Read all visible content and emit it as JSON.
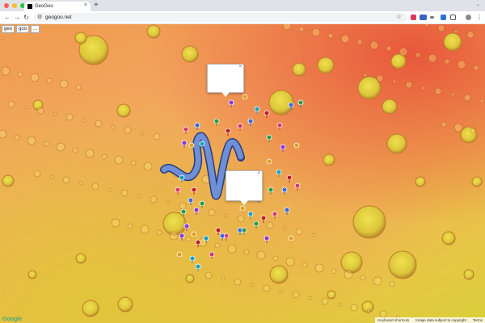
{
  "browser": {
    "tab_title": "GeoGoo",
    "tab_close": "×",
    "new_tab": "+",
    "tab_menu": "⌄",
    "url": "geogoo.net",
    "back": "←",
    "forward": "→",
    "reload": "↻",
    "menu": "⋮",
    "star": "☆",
    "traffic_lights": [
      "#ff5f57",
      "#febc2e",
      "#28c840"
    ]
  },
  "map_controls": {
    "select_1": "geo",
    "select_2": "goo",
    "select_3": "..."
  },
  "map": {
    "logo": "Google",
    "attribution": [
      "Keyboard shortcuts",
      "Image data subject to copyright",
      "Terms"
    ]
  },
  "colors": {
    "map_hot": "#e8583a",
    "map_warm": "#f3a861",
    "map_yellow": "#e2c43a",
    "crater_fill": "#e9d440",
    "snake": "#3d5ba8"
  }
}
